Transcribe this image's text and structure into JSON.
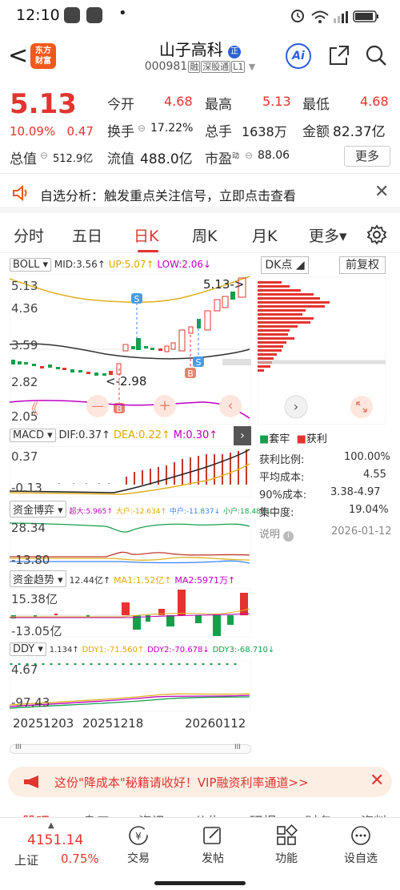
{
  "status_bar": {
    "time": "12:10",
    "dot": "•"
  },
  "header": {
    "back_icon": "chevron-left-icon",
    "logo_text": [
      "东方",
      "财富"
    ],
    "stock_name": "山子高科",
    "stock_code": "000981",
    "code_tags": [
      "融",
      "深股通",
      "L1"
    ],
    "ai_label": "Ai"
  },
  "quote": {
    "price": "5.13",
    "change_pct": "10.09%",
    "change_abs": "0.47",
    "fields": [
      {
        "label": "今开",
        "value": "4.68"
      },
      {
        "label": "最高",
        "value": "5.13"
      },
      {
        "label": "最低",
        "value": "4.68"
      },
      {
        "label": "换手",
        "value": "17.22%"
      },
      {
        "label": "总手",
        "value": "1638万"
      },
      {
        "label": "金额",
        "value": "82.37亿"
      },
      {
        "label": "总值",
        "value": "512.9亿"
      },
      {
        "label": "流值",
        "value": "488.0亿"
      },
      {
        "label": "市盈",
        "sup": "动",
        "value": "88.06"
      }
    ],
    "more_label": "更多"
  },
  "alert": {
    "text": "自选分析：触发重点关注信号，立即点击查看",
    "close": "✕"
  },
  "tabs": [
    "分时",
    "五日",
    "日K",
    "周K",
    "月K",
    "更多▾"
  ],
  "active_tab": 2,
  "kline": {
    "indicator": "BOLL",
    "mid": "MID:3.56↑",
    "up": "UP:5.07↑",
    "low": "LOW:2.06↓",
    "y_labels": [
      "5.13",
      "4.36",
      "3.59",
      "2.82",
      "2.05"
    ],
    "high_marker": "5.13->",
    "low_marker": "<-2.98",
    "s_marker": "S",
    "b_marker": "B",
    "controls": [
      "《",
      "—",
      "+",
      "‹"
    ]
  },
  "macd": {
    "name": "MACD",
    "dif": "DIF:0.37↑",
    "dea": "DEA:0.22↑",
    "m": "M:0.30↑",
    "y_top": "0.37",
    "y_bottom": "-0.13"
  },
  "zjbo": {
    "name": "资金博弈",
    "super": "超大:5.965↑",
    "big": "大户:-12.634↑",
    "mid": "中户:-11.837↓",
    "small": "小户:18.487↓",
    "y_top": "28.34",
    "y_bottom": "-13.80"
  },
  "zjqs": {
    "name": "资金趋势",
    "val": "12.44亿↑",
    "ma1": "MA1:1.52亿↑",
    "ma2": "MA2:5971万↑",
    "y_top": "15.38亿",
    "y_bottom": "-13.05亿"
  },
  "ddy": {
    "name": "DDY",
    "val": "1.134↑",
    "d1": "DDY1:-71.560↑",
    "d2": "DDY2:-70.678↓",
    "d3": "DDY3:-68.710↓",
    "y_top": "4.67",
    "y_bottom": "-97.43"
  },
  "x_dates": [
    "20251203",
    "20251218",
    "20260112"
  ],
  "dk_panel": {
    "tab1": "DK点",
    "tab2": "前复权",
    "legend1": "套牢",
    "legend2": "获利",
    "stats": [
      {
        "label": "获利比例:",
        "value": "100.00%"
      },
      {
        "label": "平均成本:",
        "value": "4.55"
      },
      {
        "label": "90%成本:",
        "value": "3.38-4.97"
      },
      {
        "label": "集中度:",
        "value": "19.04%"
      }
    ],
    "note": "说明",
    "date": "2026-01-12"
  },
  "banner": {
    "text": "这份\"降成本\"秘籍请收好！VIP融资利率通道>>",
    "close": "✕"
  },
  "bottom_bar": {
    "index_value": "4151.14",
    "index_name": "上证",
    "index_change": "0.75%",
    "items": [
      "交易",
      "发帖",
      "功能",
      "设自选"
    ]
  },
  "hidden_tabs": [
    "股吧",
    "身口",
    "资讯",
    "公告",
    "研报",
    "财务",
    "资料"
  ],
  "colors": {
    "up": "#e3342f",
    "down": "#14a04b",
    "accent": "#e3342f",
    "ai": "#2b5fd9"
  }
}
